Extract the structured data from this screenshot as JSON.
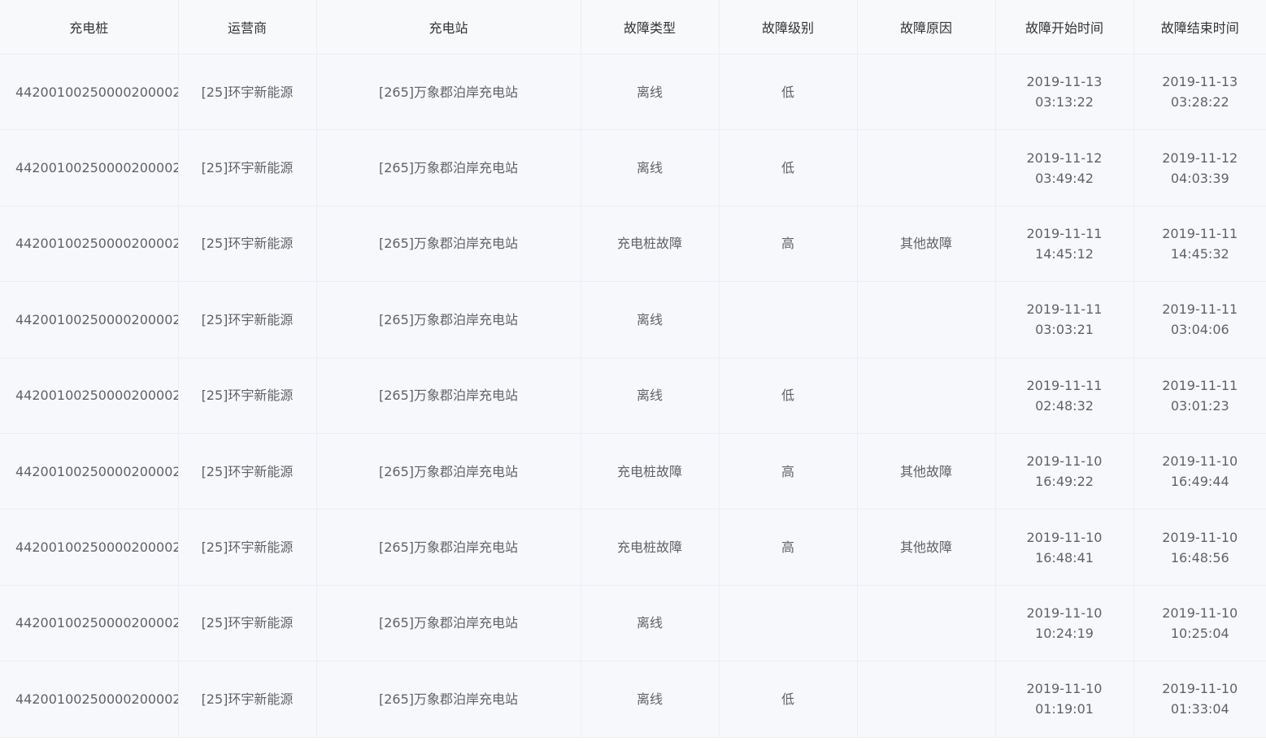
{
  "table": {
    "headers": [
      "充电桩",
      "运营商",
      "充电站",
      "故障类型",
      "故障级别",
      "故障原因",
      "故障开始时间",
      "故障结束时间"
    ],
    "rows": [
      {
        "pile": "4420010025000020000​2",
        "operator": "[25]环宇新能源",
        "station": "[265]万象郡泊岸充电站",
        "fault_type": "离线",
        "fault_level": "低",
        "fault_reason": "",
        "start_date": "2019-11-13",
        "start_time": "03:13:22",
        "end_date": "2019-11-13",
        "end_time": "03:28:22"
      },
      {
        "pile": "44200100250000200002",
        "operator": "[25]环宇新能源",
        "station": "[265]万象郡泊岸充电站",
        "fault_type": "离线",
        "fault_level": "低",
        "fault_reason": "",
        "start_date": "2019-11-12",
        "start_time": "03:49:42",
        "end_date": "2019-11-12",
        "end_time": "04:03:39"
      },
      {
        "pile": "44200100250000200002",
        "operator": "[25]环宇新能源",
        "station": "[265]万象郡泊岸充电站",
        "fault_type": "充电桩故障",
        "fault_level": "高",
        "fault_reason": "其他故障",
        "start_date": "2019-11-11",
        "start_time": "14:45:12",
        "end_date": "2019-11-11",
        "end_time": "14:45:32"
      },
      {
        "pile": "44200100250000200002",
        "operator": "[25]环宇新能源",
        "station": "[265]万象郡泊岸充电站",
        "fault_type": "离线",
        "fault_level": "",
        "fault_reason": "",
        "start_date": "2019-11-11",
        "start_time": "03:03:21",
        "end_date": "2019-11-11",
        "end_time": "03:04:06"
      },
      {
        "pile": "44200100250000200002",
        "operator": "[25]环宇新能源",
        "station": "[265]万象郡泊岸充电站",
        "fault_type": "离线",
        "fault_level": "低",
        "fault_reason": "",
        "start_date": "2019-11-11",
        "start_time": "02:48:32",
        "end_date": "2019-11-11",
        "end_time": "03:01:23"
      },
      {
        "pile": "44200100250000200002",
        "operator": "[25]环宇新能源",
        "station": "[265]万象郡泊岸充电站",
        "fault_type": "充电桩故障",
        "fault_level": "高",
        "fault_reason": "其他故障",
        "start_date": "2019-11-10",
        "start_time": "16:49:22",
        "end_date": "2019-11-10",
        "end_time": "16:49:44"
      },
      {
        "pile": "44200100250000200002",
        "operator": "[25]环宇新能源",
        "station": "[265]万象郡泊岸充电站",
        "fault_type": "充电桩故障",
        "fault_level": "高",
        "fault_reason": "其他故障",
        "start_date": "2019-11-10",
        "start_time": "16:48:41",
        "end_date": "2019-11-10",
        "end_time": "16:48:56"
      },
      {
        "pile": "44200100250000200002",
        "operator": "[25]环宇新能源",
        "station": "[265]万象郡泊岸充电站",
        "fault_type": "离线",
        "fault_level": "",
        "fault_reason": "",
        "start_date": "2019-11-10",
        "start_time": "10:24:19",
        "end_date": "2019-11-10",
        "end_time": "10:25:04"
      },
      {
        "pile": "44200100250000200002",
        "operator": "[25]环宇新能源",
        "station": "[265]万象郡泊岸充电站",
        "fault_type": "离线",
        "fault_level": "低",
        "fault_reason": "",
        "start_date": "2019-11-10",
        "start_time": "01:19:01",
        "end_date": "2019-11-10",
        "end_time": "01:33:04"
      }
    ]
  }
}
